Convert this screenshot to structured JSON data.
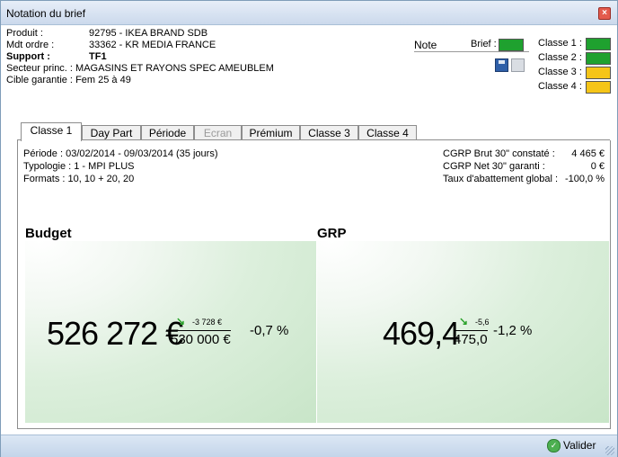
{
  "window": {
    "title": "Notation du brief"
  },
  "info": {
    "produit_label": "Produit :",
    "produit": "92795 - IKEA BRAND SDB",
    "mdt_label": "Mdt ordre :",
    "mdt": "33362 - KR MEDIA FRANCE",
    "support_label": "Support :",
    "support": "TF1",
    "secteur_label": "Secteur princ. :",
    "secteur": "MAGASINS ET RAYONS SPEC AMEUBLEM",
    "cible_label": "Cible garantie :",
    "cible": "Fem 25 à 49"
  },
  "note": {
    "label": "Note",
    "brief_label": "Brief :",
    "brief_color": "#1fa12f",
    "classes": [
      {
        "label": "Classe 1 :",
        "color": "#1fa12f"
      },
      {
        "label": "Classe 2 :",
        "color": "#1fa12f"
      },
      {
        "label": "Classe 3 :",
        "color": "#f5c518"
      },
      {
        "label": "Classe 4 :",
        "color": "#f5c518"
      }
    ],
    "icons": [
      "save-icon",
      "copy-icon"
    ]
  },
  "tabs": [
    {
      "label": "Classe 1",
      "active": true
    },
    {
      "label": "Day Part"
    },
    {
      "label": "Période"
    },
    {
      "label": "Ecran",
      "disabled": true
    },
    {
      "label": "Prémium"
    },
    {
      "label": "Classe 3"
    },
    {
      "label": "Classe 4"
    }
  ],
  "panel": {
    "periode": "Période :   03/02/2014 - 09/03/2014 (35 jours)",
    "typologie": "Typologie : 1 - MPI PLUS",
    "formats": "Formats :   10, 10 + 20, 20",
    "stats": [
      {
        "label": "CGRP Brut 30\" constaté :",
        "value": "4 465 €"
      },
      {
        "label": "CGRP Net 30\" garanti :",
        "value": "0 €"
      },
      {
        "label": "Taux d'abattement global :",
        "value": "-100,0 %"
      }
    ],
    "budget": {
      "title": "Budget",
      "value": "526 272 €",
      "delta": "-3 728 €",
      "target": "530 000 €",
      "pct": "-0,7 %"
    },
    "grp": {
      "title": "GRP",
      "value": "469,4",
      "delta": "-5,6",
      "target": "475,0",
      "pct": "-1,2 %"
    }
  },
  "footer": {
    "valider": "Valider"
  }
}
